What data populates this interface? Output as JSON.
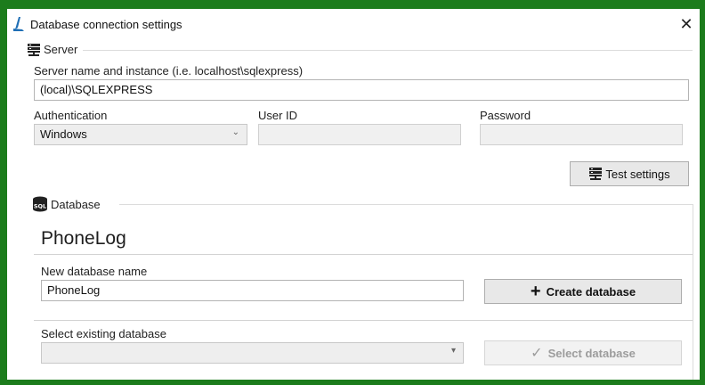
{
  "window": {
    "title": "Database connection settings",
    "close_glyph": "✕"
  },
  "server": {
    "legend": "Server",
    "name_label": "Server name and instance (i.e. localhost\\sqlexpress)",
    "name_value": "(local)\\SQLEXPRESS",
    "auth_label": "Authentication",
    "auth_value": "Windows",
    "auth_arrow": "⌄",
    "userid_label": "User ID",
    "userid_value": "",
    "password_label": "Password",
    "password_value": "",
    "test_button": "Test settings"
  },
  "database": {
    "legend": "Database",
    "current": "PhoneLog",
    "new_label": "New database name",
    "new_value": "PhoneLog",
    "create_button": "Create database",
    "create_glyph": "+",
    "select_label": "Select existing database",
    "select_value": "",
    "select_arrow": "▾",
    "select_button": "Select database",
    "select_glyph": "✓"
  },
  "colors": {
    "frame": "#1c7c1c",
    "app_icon": "#1f6fb5"
  },
  "icons": [
    "app-icon",
    "close-icon",
    "server-icon",
    "sql-database-icon",
    "plus-icon",
    "check-icon"
  ]
}
